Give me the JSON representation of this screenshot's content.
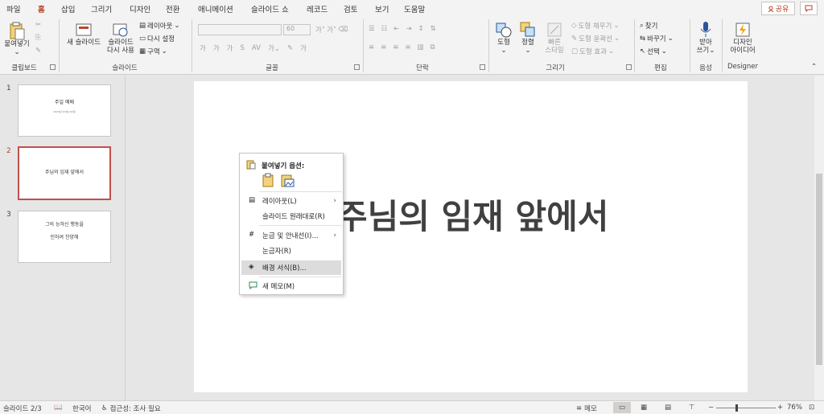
{
  "tabs": [
    "파일",
    "홈",
    "삽입",
    "그리기",
    "디자인",
    "전환",
    "애니메이션",
    "슬라이드 쇼",
    "레코드",
    "검토",
    "보기",
    "도움말"
  ],
  "active_tab": "홈",
  "share_label": "공유",
  "ribbon": {
    "clipboard": {
      "paste": "붙여넣기",
      "label": "클립보드"
    },
    "slides": {
      "new_slide_1": "새 슬라이드",
      "reuse_1": "슬라이드",
      "reuse_2": "다시 사용",
      "layout": "레이아웃",
      "reset": "다시 설정",
      "section": "구역",
      "label": "슬라이드"
    },
    "font": {
      "size": "60",
      "label": "글꼴"
    },
    "paragraph": {
      "label": "단락"
    },
    "drawing": {
      "shapes": "도형",
      "arrange": "정렬",
      "quick_1": "빠른",
      "quick_2": "스타일",
      "fill": "도형 채우기",
      "outline": "도형 윤곽선",
      "effects": "도형 효과",
      "label": "그리기"
    },
    "editing": {
      "find": "찾기",
      "replace": "바꾸기",
      "select": "선택",
      "label": "편집"
    },
    "voice": {
      "dictate_1": "받아",
      "dictate_2": "쓰기",
      "label": "음성"
    },
    "designer": {
      "idea_1": "디자인",
      "idea_2": "아이디어",
      "label": "Designer"
    }
  },
  "slides": [
    {
      "num": "1",
      "title": "주일 예배",
      "sub": "2024년 OO월 OO일"
    },
    {
      "num": "2",
      "title": "주님의 임재 앞에서",
      "sub": ""
    },
    {
      "num": "3",
      "title": "그의 능하신 행동을",
      "sub": "인하여 찬양해"
    }
  ],
  "current_slide_title": "주님의 임재 앞에서",
  "context_menu": {
    "header": "붙여넣기 옵션:",
    "items": [
      {
        "label": "레이아웃(L)",
        "submenu": true
      },
      {
        "label": "슬라이드 원래대로(R)",
        "submenu": false
      },
      {
        "label": "눈금 및 안내선(I)...",
        "submenu": true
      },
      {
        "label": "눈금자(R)",
        "submenu": false
      },
      {
        "label": "배경 서식(B)...",
        "submenu": false
      },
      {
        "label": "새 메모(M)",
        "submenu": false
      }
    ]
  },
  "status": {
    "slide_pos": "슬라이드 2/3",
    "language": "한국어",
    "accessibility": "접근성: 조사 필요",
    "notes": "메모",
    "zoom": "76%"
  },
  "colors": {
    "accent": "#b7472a",
    "selected_thumb_border": "#c0504d"
  }
}
